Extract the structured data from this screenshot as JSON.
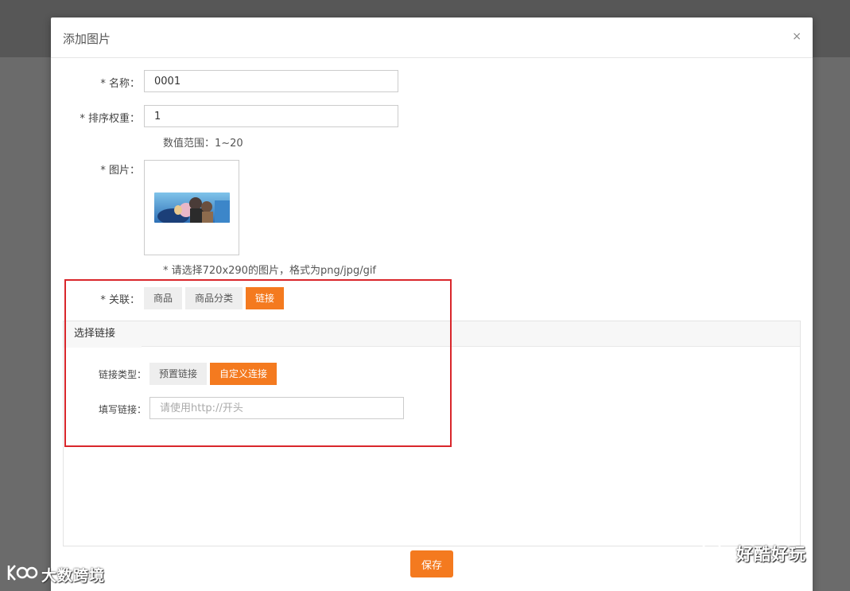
{
  "modal": {
    "title": "添加图片",
    "close": "×"
  },
  "form": {
    "name_label": "* 名称：",
    "name_value": "0001",
    "sort_label": "* 排序权重：",
    "sort_value": "1",
    "sort_hint": "数值范围：1~20",
    "image_label": "* 图片：",
    "image_hint": "* 请选择720x290的图片，格式为png/jpg/gif",
    "link_label": "* 关联：",
    "link_options": [
      "商品",
      "商品分类",
      "链接"
    ],
    "link_selected": "链接"
  },
  "panel": {
    "tab": "选择链接",
    "type_label": "链接类型：",
    "type_options": [
      "预置链接",
      "自定义连接"
    ],
    "type_selected": "自定义连接",
    "url_label": "填写链接：",
    "url_placeholder": "请使用http://开头"
  },
  "footer": {
    "save_label": "保存"
  },
  "watermarks": {
    "right": "好酷好玩",
    "left": "大数跨境"
  },
  "colors": {
    "accent": "#f47a1f",
    "highlight": "#d9262b"
  }
}
